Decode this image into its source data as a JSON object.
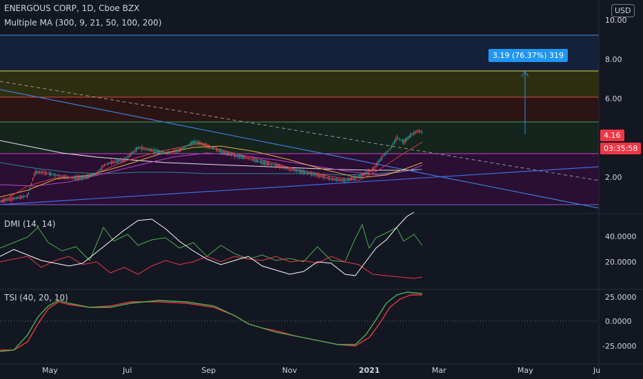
{
  "header": {
    "symbol": "ENERGOUS CORP, 1D, Cboe BZX",
    "indicator": "Multiple MA (300, 9, 21, 50, 100, 200)"
  },
  "currency_button": "USD",
  "price_axis": {
    "ticks": [
      "10.00",
      "8.00",
      "6.00",
      "2.00"
    ],
    "last_price": "4.16",
    "countdown": "03:35:58"
  },
  "measure_label": "3.19 (76.37%) 319",
  "dmi": {
    "title": "DMI (14, 14)",
    "ticks": [
      "40.0000",
      "20.0000"
    ]
  },
  "tsi": {
    "title": "TSI (40, 20, 10)",
    "ticks": [
      "25.0000",
      "0.0000",
      "-25.0000"
    ]
  },
  "time_axis": {
    "labels": [
      "May",
      "Jul",
      "Sep",
      "Nov",
      "2021",
      "Mar",
      "May",
      "Ju"
    ]
  },
  "colors": {
    "background": "#131722",
    "up_candle": "#26a69a",
    "down_candle": "#ef5350",
    "dmi_plus": "#4caf50",
    "dmi_minus": "#f23645",
    "adx": "#ffffff",
    "tsi": "#4caf50",
    "tsi_signal": "#f23645",
    "price_badge": "#f23645",
    "measure": "#2196f3"
  }
}
